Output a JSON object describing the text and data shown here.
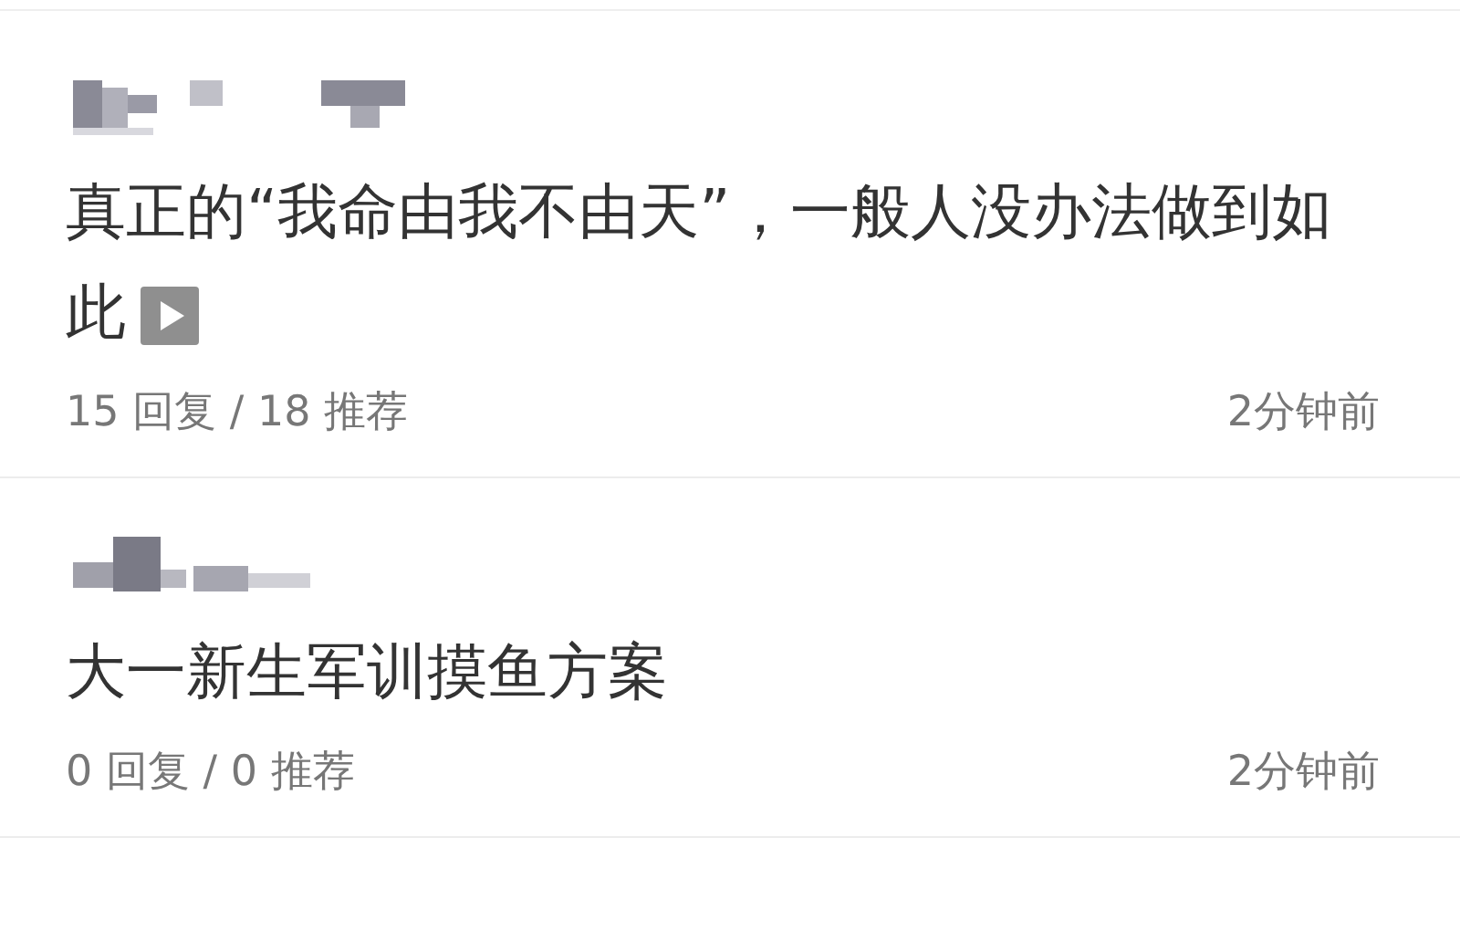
{
  "posts": [
    {
      "title": "真正的“我命由我不由天”，一般人没办法做到如此",
      "has_video": true,
      "stats": "15 回复 / 18 推荐",
      "time": "2分钟前"
    },
    {
      "title": "大一新生军训摸鱼方案",
      "has_video": false,
      "stats": "0 回复 / 0 推荐",
      "time": "2分钟前"
    }
  ]
}
